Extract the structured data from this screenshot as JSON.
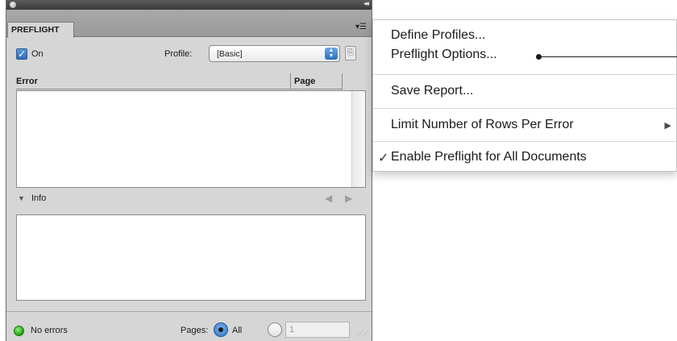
{
  "panel": {
    "tab_label": "PREFLIGHT",
    "collapse_glyph": "◂◂",
    "menu_glyph": "▾☰",
    "on_label": "On",
    "on_checked": true,
    "profile_label": "Profile:",
    "profile_value": "[Basic]",
    "columns": {
      "error": "Error",
      "page": "Page"
    },
    "info_label": "Info",
    "status_text": "No errors",
    "status_color": "#2fb51f",
    "pages_label": "Pages:",
    "pages_all_label": "All",
    "pages_range_placeholder": "1",
    "icons": [
      "close-dot-icon",
      "collapse-icon",
      "panel-menu-icon",
      "checkbox-check-icon",
      "select-arrows-icon",
      "profile-document-icon",
      "disclosure-triangle-icon",
      "previous-arrow-icon",
      "next-arrow-icon",
      "status-dot-icon",
      "resize-grip-icon"
    ]
  },
  "flyout_menu": {
    "items": [
      {
        "label": "Define Profiles..."
      },
      {
        "label": "Preflight Options..."
      },
      {
        "label": "Save Report..."
      },
      {
        "label": "Limit Number of Rows Per Error",
        "has_submenu": true
      },
      {
        "label": "Enable Preflight for All Documents",
        "checked": true
      }
    ]
  },
  "accent_colors": {
    "selection_blue": "#2f6db5",
    "status_green": "#2fb51f"
  }
}
